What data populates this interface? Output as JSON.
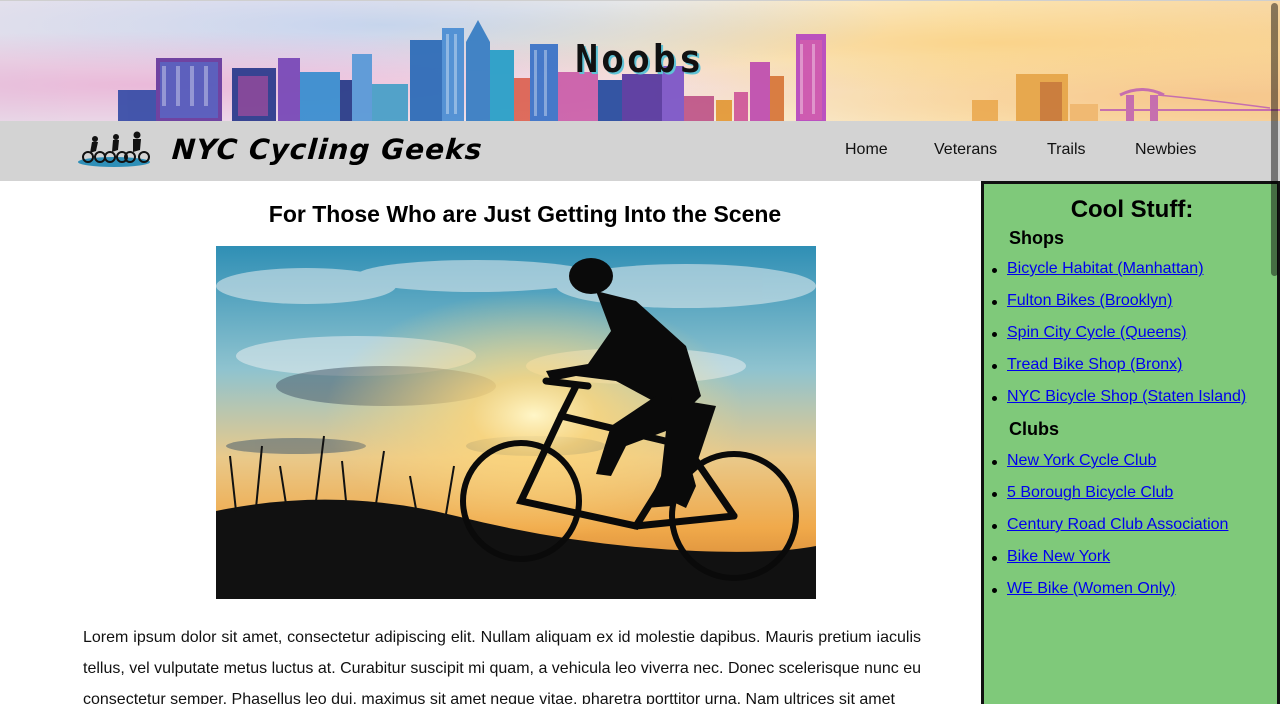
{
  "banner": {
    "title": "Noobs"
  },
  "header": {
    "site_name": "NYC Cycling Geeks",
    "nav": {
      "home": "Home",
      "veterans": "Veterans",
      "trails": "Trails",
      "newbies": "Newbies"
    }
  },
  "main": {
    "heading": "For Those Who are Just Getting Into the Scene",
    "hero_image": "cyclist-silhouette-sunset",
    "body": "Lorem ipsum dolor sit amet, consectetur adipiscing elit. Nullam aliquam ex id molestie dapibus. Mauris pretium iaculis tellus, vel vulputate metus luctus at. Curabitur suscipit mi quam, a vehicula leo viverra nec. Donec scelerisque nunc eu consectetur semper. Phasellus leo dui, maximus sit amet neque vitae, pharetra porttitor urna. Nam ultrices sit amet"
  },
  "sidebar": {
    "title": "Cool Stuff:",
    "shops_heading": "Shops",
    "shops": [
      "Bicycle Habitat (Manhattan)",
      "Fulton Bikes (Brooklyn)",
      "Spin City Cycle (Queens)",
      "Tread Bike Shop (Bronx)",
      "NYC Bicycle Shop (Staten Island)"
    ],
    "clubs_heading": "Clubs",
    "clubs": [
      "New York Cycle Club",
      "5 Borough Bicycle Club",
      "Century Road Club Association",
      "Bike New York",
      "WE Bike (Women Only)"
    ]
  },
  "colors": {
    "navbar_bg": "#d3d3d3",
    "sidebar_bg": "#7fc97a",
    "link": "#0000ee"
  }
}
